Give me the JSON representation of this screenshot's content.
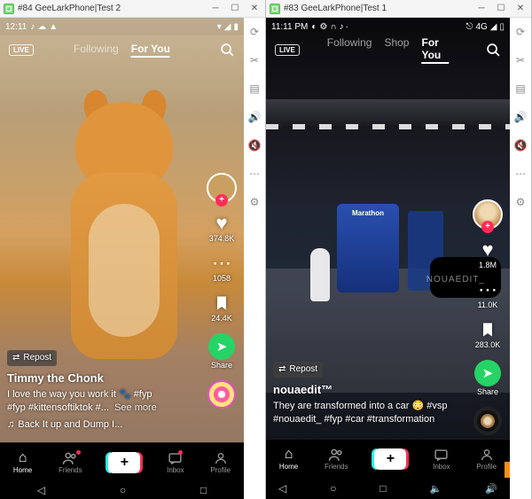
{
  "windows": [
    {
      "title": "#84 GeeLarkPhone|Test 2",
      "statusbar": {
        "time": "12:11",
        "right_text": ""
      },
      "nav": {
        "following": "Following",
        "foryou": "For You",
        "active": "foryou"
      },
      "actions": {
        "likes": "374.8K",
        "comments": "1058",
        "saves": "24.4K",
        "share": "Share"
      },
      "caption": {
        "repost": "Repost",
        "username": "Timmy the Chonk",
        "line1": "I love the way you work it 🐾 #fyp",
        "line2": "#fyp #kittensoftiktok #...",
        "seemore": "See more",
        "sound": "Back It up and Dump I..."
      },
      "bottom": {
        "home": "Home",
        "friends": "Friends",
        "inbox": "Inbox",
        "profile": "Profile"
      }
    },
    {
      "title": "#83 GeeLarkPhone|Test 1",
      "statusbar": {
        "time": "11:11 PM",
        "right_text": "4G"
      },
      "nav": {
        "following": "Following",
        "shop": "Shop",
        "foryou": "For You",
        "active": "foryou"
      },
      "actions": {
        "likes": "1.8M",
        "comments": "11.0K",
        "saves": "283.0K",
        "share": "Share"
      },
      "pump_brand": "Marathon",
      "watermark": "NOUAEDIT_",
      "caption": {
        "repost": "Repost",
        "username": "nouaedit™",
        "line1": "They are transformed into a car 😳 #vsp",
        "line2": "#nouaedit_ #fyp #car #transformation"
      },
      "bottom": {
        "home": "Home",
        "friends": "Friends",
        "inbox": "Inbox",
        "profile": "Profile"
      }
    }
  ]
}
